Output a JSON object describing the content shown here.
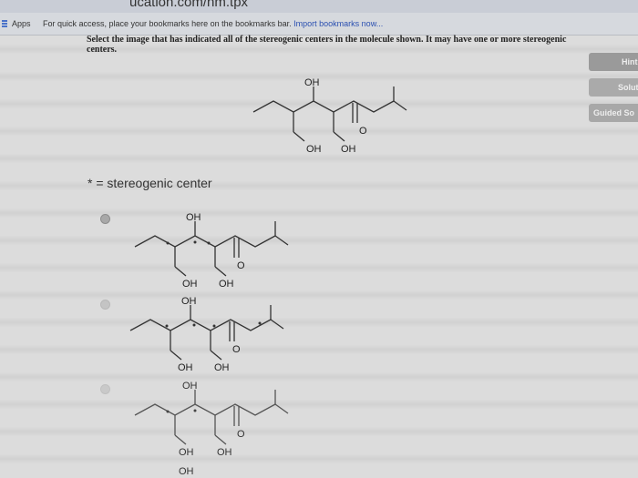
{
  "browser": {
    "url_fragment": "ucation.com/hm.tpx",
    "apps_label": "Apps",
    "bookmarks_hint": "For quick access, place your bookmarks here on the bookmarks bar.",
    "import_link": "Import bookmarks now..."
  },
  "question": {
    "text": "Select the image that has indicated all of the stereogenic centers in the molecule shown. It may have one or more stereogenic centers."
  },
  "side_buttons": {
    "hint": "Hint",
    "solution": "Solutio",
    "guided": "Guided So"
  },
  "molecule_labels": {
    "oh": "OH",
    "o": "O"
  },
  "legend": {
    "text": "* = stereogenic center"
  },
  "options": [
    {
      "selected": true
    },
    {
      "selected": false
    },
    {
      "selected": false
    }
  ],
  "colors": {
    "radio": "#a8a8a8",
    "side_button": "#9a9a9a"
  }
}
